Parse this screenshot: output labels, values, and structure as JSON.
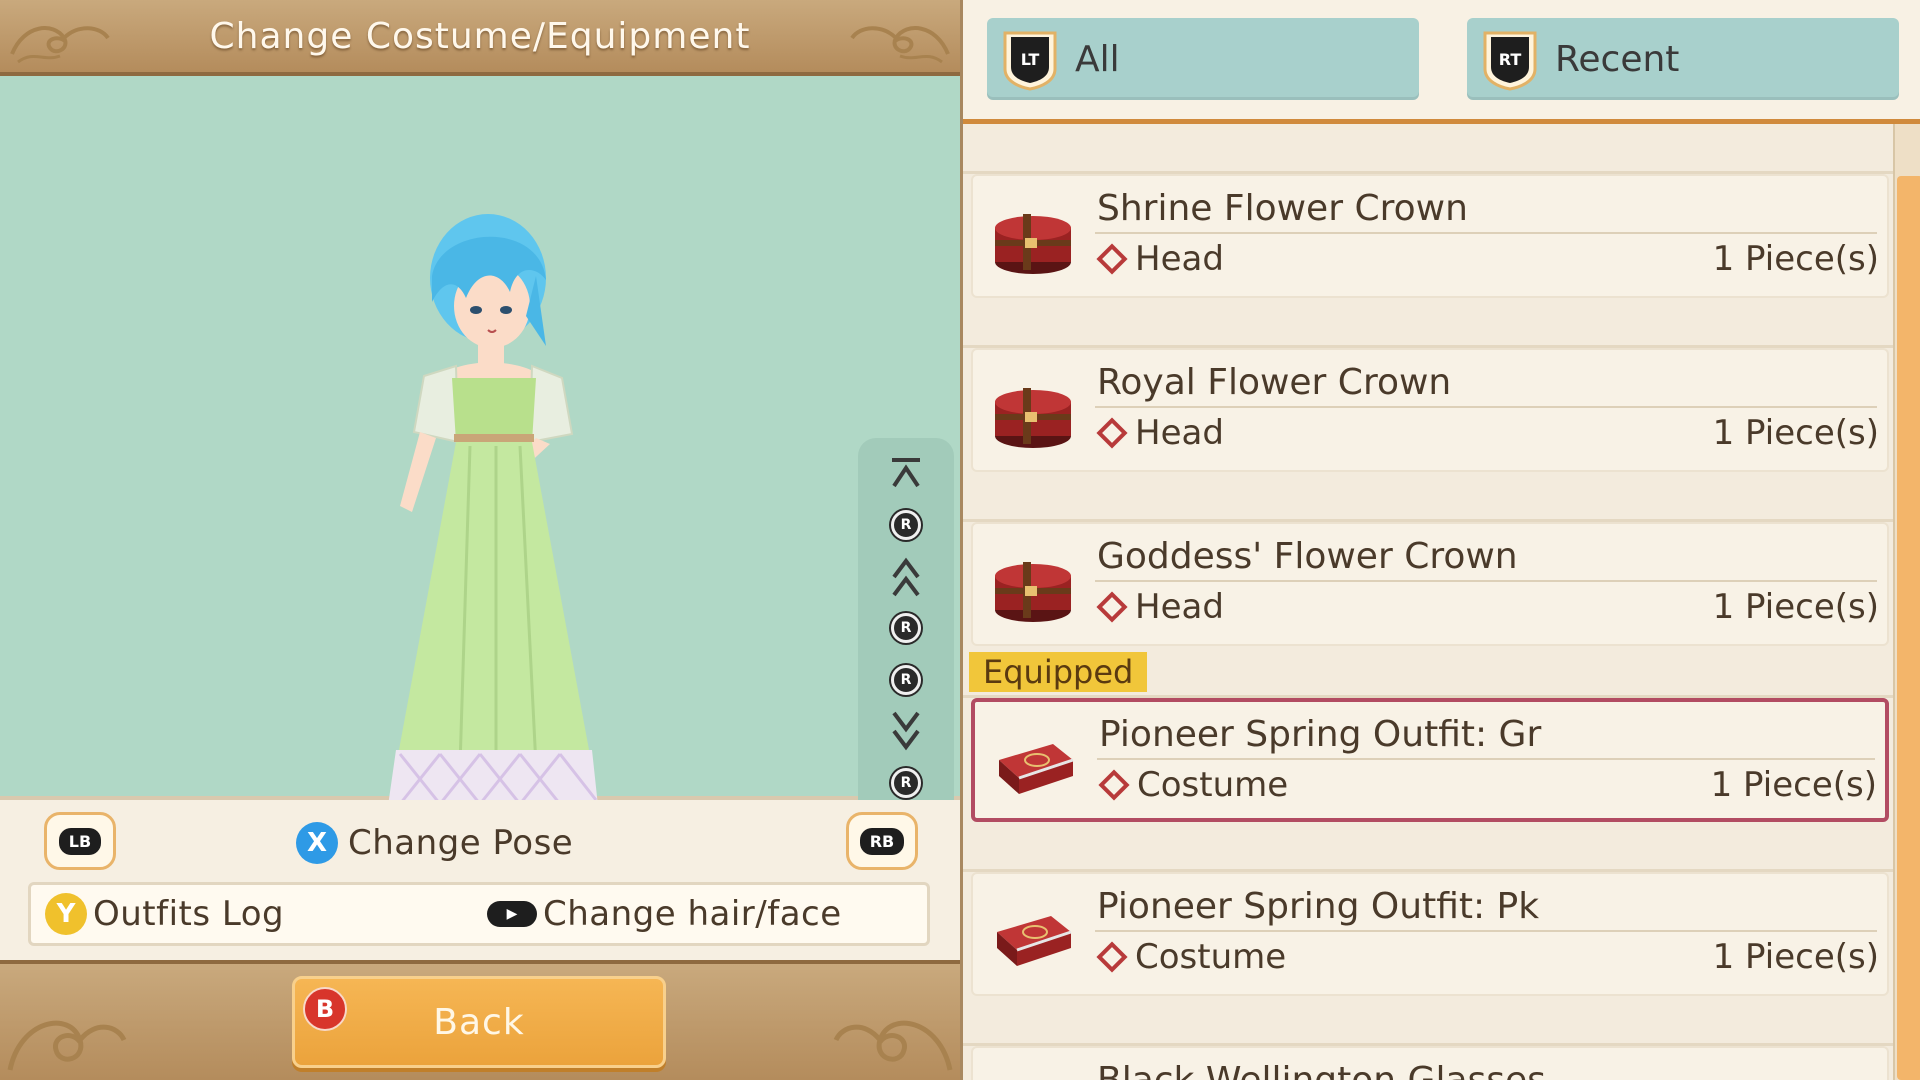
{
  "title": "Change Costume/Equipment",
  "controls": {
    "lb": "LB",
    "rb": "RB",
    "x_glyph": "X",
    "change_pose": "Change Pose",
    "y_glyph": "Y",
    "outfits_log": "Outfits Log",
    "change_hair_face": "Change hair/face"
  },
  "camera": {
    "r_glyph": "R"
  },
  "back": {
    "b_glyph": "B",
    "label": "Back"
  },
  "tabs": [
    {
      "badge": "LT",
      "label": "All"
    },
    {
      "badge": "RT",
      "label": "Recent"
    }
  ],
  "equipped_tag": "Equipped",
  "items": [
    {
      "name": "Shrine Flower Crown",
      "slot": "Head",
      "qty": "1 Piece(s)",
      "icon": "hat-box-icon"
    },
    {
      "name": "Royal Flower Crown",
      "slot": "Head",
      "qty": "1 Piece(s)",
      "icon": "hat-box-icon"
    },
    {
      "name": "Goddess' Flower Crown",
      "slot": "Head",
      "qty": "1 Piece(s)",
      "icon": "hat-box-icon"
    },
    {
      "name": "Pioneer Spring Outfit: Gr",
      "slot": "Costume",
      "qty": "1 Piece(s)",
      "icon": "suitcase-icon",
      "equipped": true
    },
    {
      "name": "Pioneer Spring Outfit: Pk",
      "slot": "Costume",
      "qty": "1 Piece(s)",
      "icon": "suitcase-icon"
    },
    {
      "name": "Black Wellington Glasses"
    }
  ],
  "colors": {
    "preview_bg": "#b0d8c6",
    "tab_bg": "#a8d0cc",
    "accent_orange": "#f3b56a",
    "equipped_border": "#b24c62",
    "equipped_tag": "#f1c63a"
  }
}
